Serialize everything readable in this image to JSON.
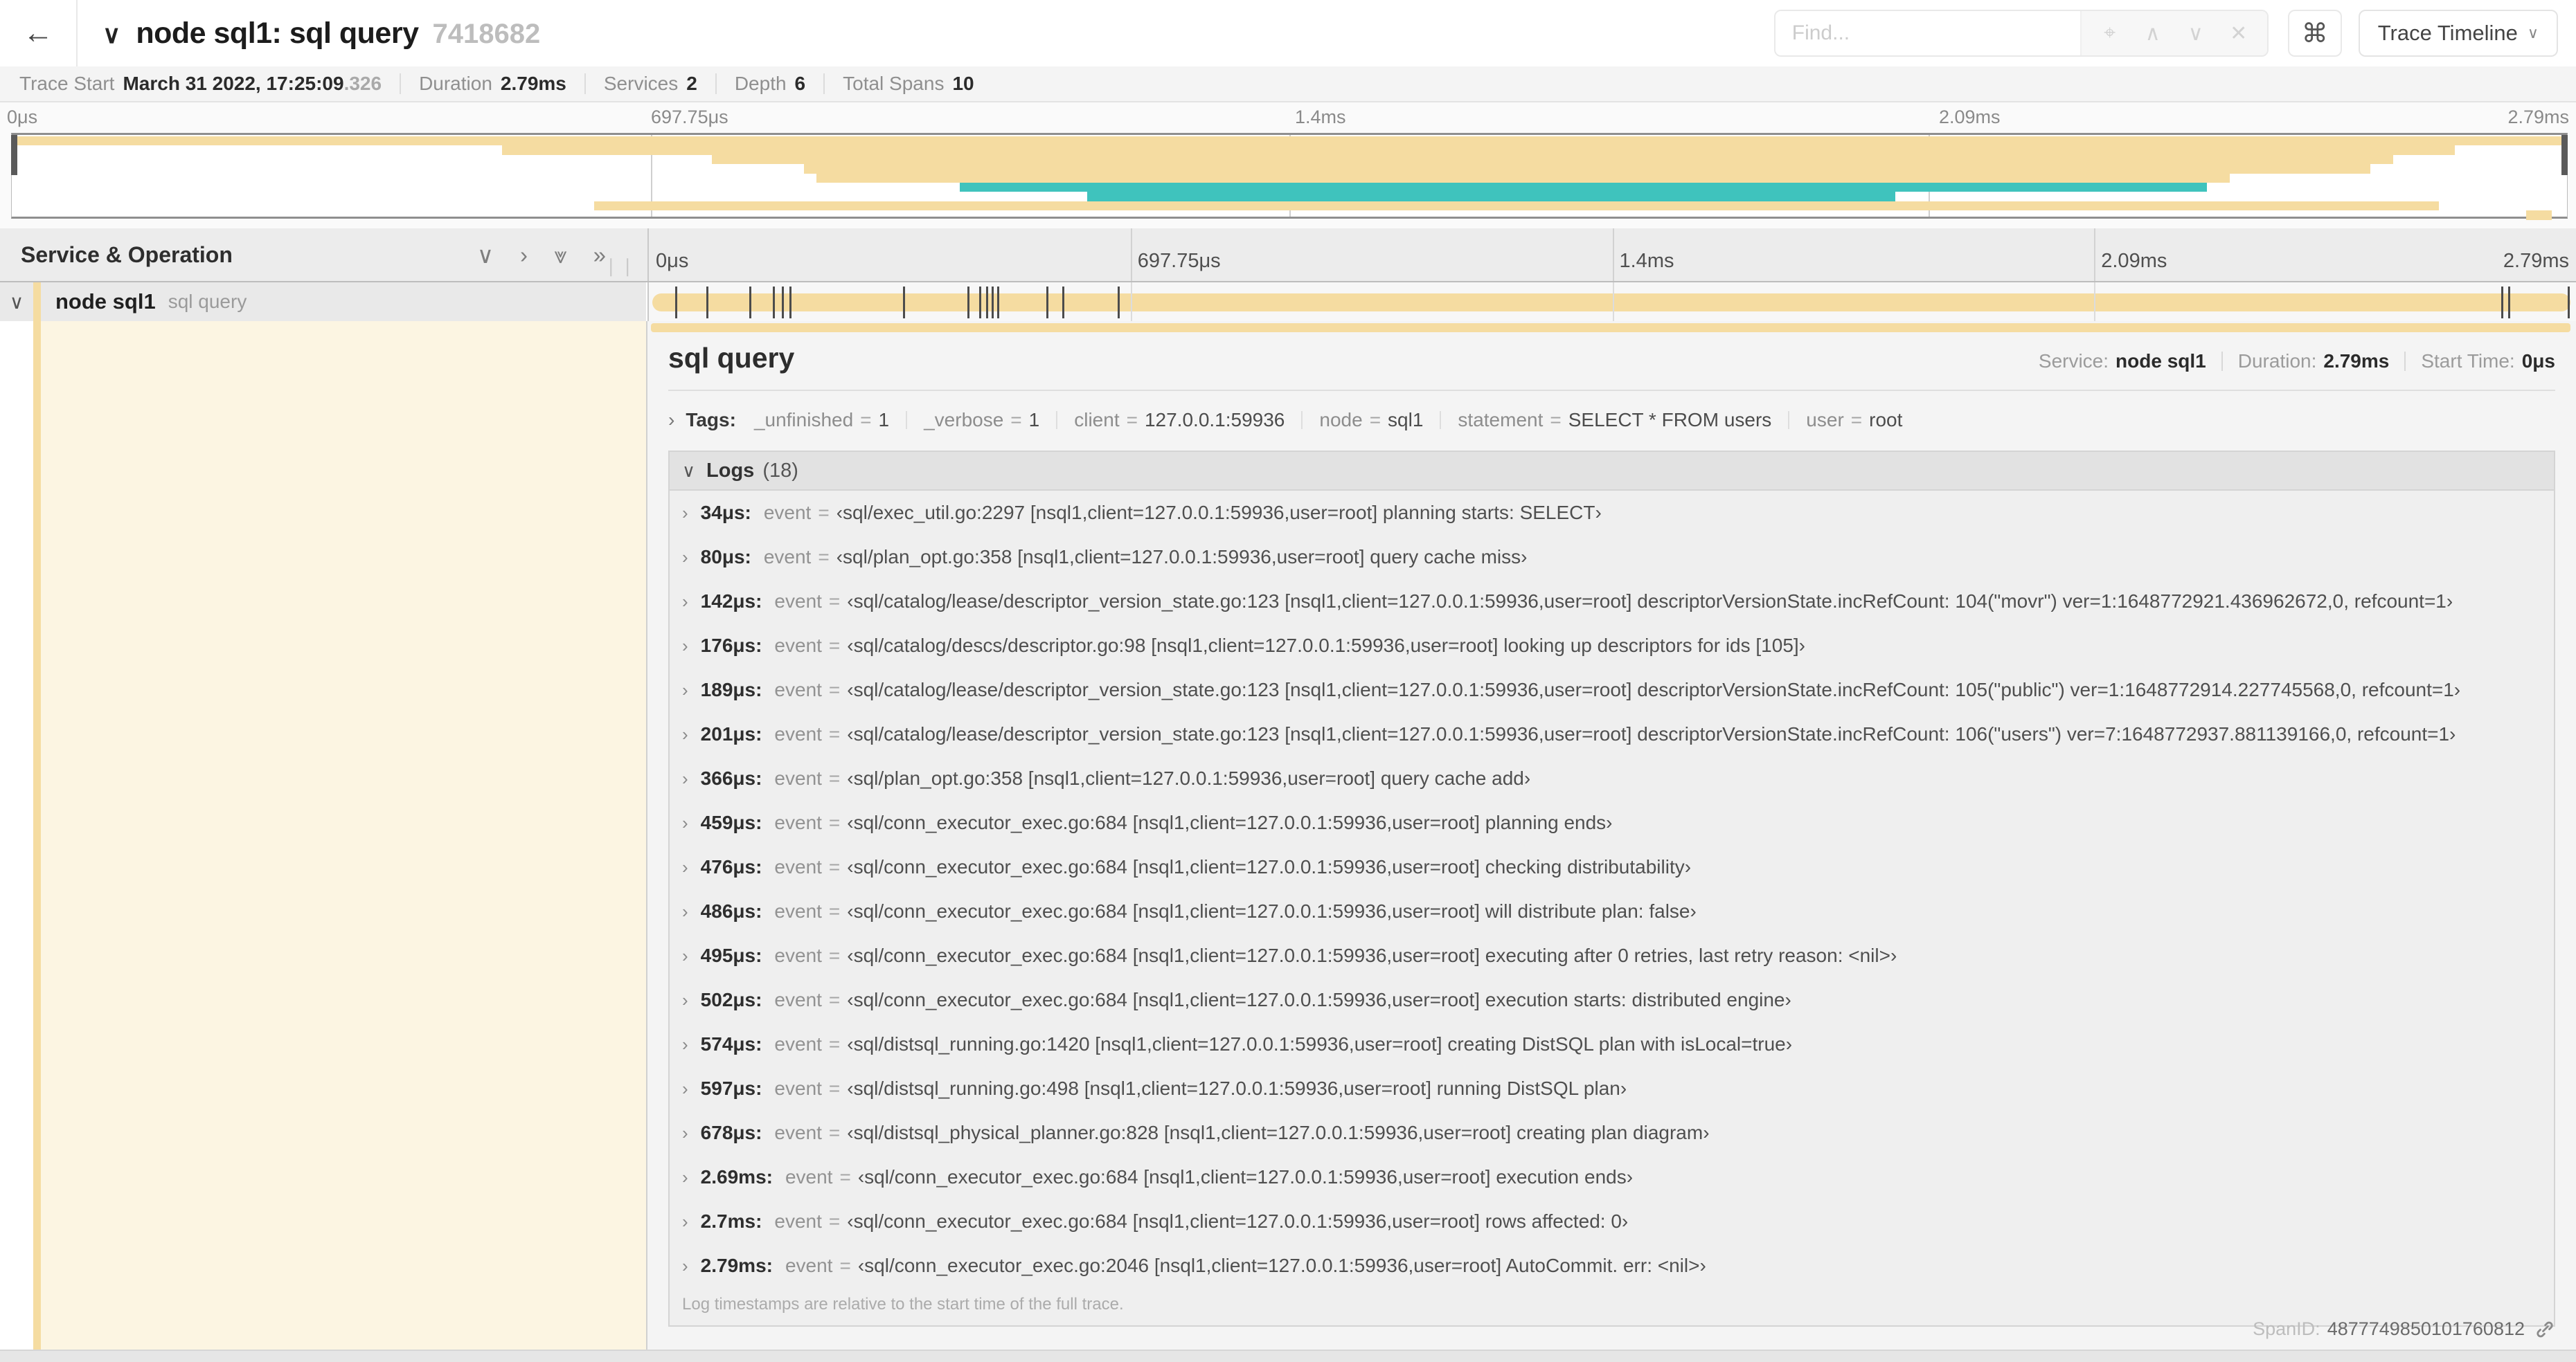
{
  "colors": {
    "tan": "#F5DCA1",
    "teal": "#3FC3BD",
    "cream": "#FCF5E2",
    "tick": "#4C4C4C"
  },
  "header": {
    "back_icon": "←",
    "collapse_chevron": "∨",
    "title": "node sql1: sql query",
    "trace_id": "7418682",
    "find_placeholder": "Find...",
    "find_icons": [
      {
        "name": "locate-icon",
        "glyph": "⌖"
      },
      {
        "name": "prev-match-icon",
        "glyph": "∧"
      },
      {
        "name": "next-match-icon",
        "glyph": "∨"
      },
      {
        "name": "clear-icon",
        "glyph": "✕"
      }
    ],
    "shortcut_button": "⌘",
    "view_button": "Trace Timeline",
    "view_button_chevron": "∨"
  },
  "trace_info": {
    "items": [
      {
        "label": "Trace Start",
        "value": "March 31 2022, 17:25:09",
        "suffix": ".326"
      },
      {
        "label": "Duration",
        "value": "2.79ms",
        "suffix": ""
      },
      {
        "label": "Services",
        "value": "2",
        "suffix": ""
      },
      {
        "label": "Depth",
        "value": "6",
        "suffix": ""
      },
      {
        "label": "Total Spans",
        "value": "10",
        "suffix": ""
      }
    ]
  },
  "minimap": {
    "tick_labels": [
      "0μs",
      "697.75μs",
      "1.4ms",
      "2.09ms",
      "2.79ms"
    ],
    "grid_pcts": [
      25,
      50,
      75
    ],
    "spans": [
      {
        "start": 0,
        "end": 100,
        "color": "tan"
      },
      {
        "start": 19.2,
        "end": 95.6,
        "color": "tan"
      },
      {
        "start": 27.4,
        "end": 93.2,
        "color": "tan"
      },
      {
        "start": 31.0,
        "end": 92.3,
        "color": "tan"
      },
      {
        "start": 31.5,
        "end": 86.8,
        "color": "tan"
      },
      {
        "start": 37.1,
        "end": 85.9,
        "color": "teal"
      },
      {
        "start": 42.1,
        "end": 73.7,
        "color": "teal"
      },
      {
        "start": 22.8,
        "end": 95.0,
        "color": "tan"
      },
      {
        "start": 98.4,
        "end": 99.4,
        "color": "tan"
      }
    ]
  },
  "timeline": {
    "column_header": "Service & Operation",
    "collapse_icons": [
      {
        "name": "collapse-one-icon",
        "glyph": "∨"
      },
      {
        "name": "expand-one-icon",
        "glyph": "›"
      },
      {
        "name": "collapse-all-icon",
        "glyph": "⩔"
      },
      {
        "name": "expand-all-icon",
        "glyph": "»"
      }
    ],
    "resizer_glyph": "❘❘",
    "ruler_labels": [
      "0μs",
      "697.75μs",
      "1.4ms",
      "2.09ms",
      "2.79ms"
    ],
    "grid_pcts": [
      25,
      50,
      75
    ]
  },
  "span_row": {
    "chevron": "∨",
    "service": "node sql1",
    "operation": "sql query",
    "bar": {
      "start_pct": 0,
      "end_pct": 100,
      "color": "tan"
    },
    "log_tick_pcts": [
      1.22,
      2.87,
      5.09,
      6.31,
      6.77,
      7.2,
      13.12,
      16.45,
      17.06,
      17.42,
      17.74,
      18.0,
      20.57,
      21.4,
      24.3,
      96.42,
      96.77,
      99.9
    ]
  },
  "detail": {
    "title": "sql query",
    "meta": [
      {
        "label": "Service:",
        "value": "node sql1"
      },
      {
        "label": "Duration:",
        "value": "2.79ms"
      },
      {
        "label": "Start Time:",
        "value": "0μs"
      }
    ],
    "tags": {
      "chevron": "›",
      "label": "Tags:",
      "items": [
        {
          "key": "_unfinished",
          "value": "1"
        },
        {
          "key": "_verbose",
          "value": "1"
        },
        {
          "key": "client",
          "value": "127.0.0.1:59936"
        },
        {
          "key": "node",
          "value": "sql1"
        },
        {
          "key": "statement",
          "value": "SELECT * FROM users"
        },
        {
          "key": "user",
          "value": "root"
        }
      ]
    },
    "logs": {
      "chevron": "∨",
      "label": "Logs",
      "count": "(18)",
      "row_chevron": "›",
      "field": "event",
      "entries": [
        {
          "ts": "34μs:",
          "value": "‹sql/exec_util.go:2297 [nsql1,client=127.0.0.1:59936,user=root] planning starts: SELECT›"
        },
        {
          "ts": "80μs:",
          "value": "‹sql/plan_opt.go:358 [nsql1,client=127.0.0.1:59936,user=root] query cache miss›"
        },
        {
          "ts": "142μs:",
          "value": "‹sql/catalog/lease/descriptor_version_state.go:123 [nsql1,client=127.0.0.1:59936,user=root] descriptorVersionState.incRefCount: 104(\"movr\") ver=1:1648772921.436962672,0, refcount=1›"
        },
        {
          "ts": "176μs:",
          "value": "‹sql/catalog/descs/descriptor.go:98 [nsql1,client=127.0.0.1:59936,user=root] looking up descriptors for ids [105]›"
        },
        {
          "ts": "189μs:",
          "value": "‹sql/catalog/lease/descriptor_version_state.go:123 [nsql1,client=127.0.0.1:59936,user=root] descriptorVersionState.incRefCount: 105(\"public\") ver=1:1648772914.227745568,0, refcount=1›"
        },
        {
          "ts": "201μs:",
          "value": "‹sql/catalog/lease/descriptor_version_state.go:123 [nsql1,client=127.0.0.1:59936,user=root] descriptorVersionState.incRefCount: 106(\"users\") ver=7:1648772937.881139166,0, refcount=1›"
        },
        {
          "ts": "366μs:",
          "value": "‹sql/plan_opt.go:358 [nsql1,client=127.0.0.1:59936,user=root] query cache add›"
        },
        {
          "ts": "459μs:",
          "value": "‹sql/conn_executor_exec.go:684 [nsql1,client=127.0.0.1:59936,user=root] planning ends›"
        },
        {
          "ts": "476μs:",
          "value": "‹sql/conn_executor_exec.go:684 [nsql1,client=127.0.0.1:59936,user=root] checking distributability›"
        },
        {
          "ts": "486μs:",
          "value": "‹sql/conn_executor_exec.go:684 [nsql1,client=127.0.0.1:59936,user=root] will distribute plan: false›"
        },
        {
          "ts": "495μs:",
          "value": "‹sql/conn_executor_exec.go:684 [nsql1,client=127.0.0.1:59936,user=root] executing after 0 retries, last retry reason: <nil>›"
        },
        {
          "ts": "502μs:",
          "value": "‹sql/conn_executor_exec.go:684 [nsql1,client=127.0.0.1:59936,user=root] execution starts: distributed engine›"
        },
        {
          "ts": "574μs:",
          "value": "‹sql/distsql_running.go:1420 [nsql1,client=127.0.0.1:59936,user=root] creating DistSQL plan with isLocal=true›"
        },
        {
          "ts": "597μs:",
          "value": "‹sql/distsql_running.go:498 [nsql1,client=127.0.0.1:59936,user=root] running DistSQL plan›"
        },
        {
          "ts": "678μs:",
          "value": "‹sql/distsql_physical_planner.go:828 [nsql1,client=127.0.0.1:59936,user=root] creating plan diagram›"
        },
        {
          "ts": "2.69ms:",
          "value": "‹sql/conn_executor_exec.go:684 [nsql1,client=127.0.0.1:59936,user=root] execution ends›"
        },
        {
          "ts": "2.7ms:",
          "value": "‹sql/conn_executor_exec.go:684 [nsql1,client=127.0.0.1:59936,user=root] rows affected: 0›"
        },
        {
          "ts": "2.79ms:",
          "value": "‹sql/conn_executor_exec.go:2046 [nsql1,client=127.0.0.1:59936,user=root] AutoCommit. err: <nil>›"
        }
      ],
      "note": "Log timestamps are relative to the start time of the full trace."
    },
    "span_id_label": "SpanID:",
    "span_id": "4877749850101760812"
  }
}
